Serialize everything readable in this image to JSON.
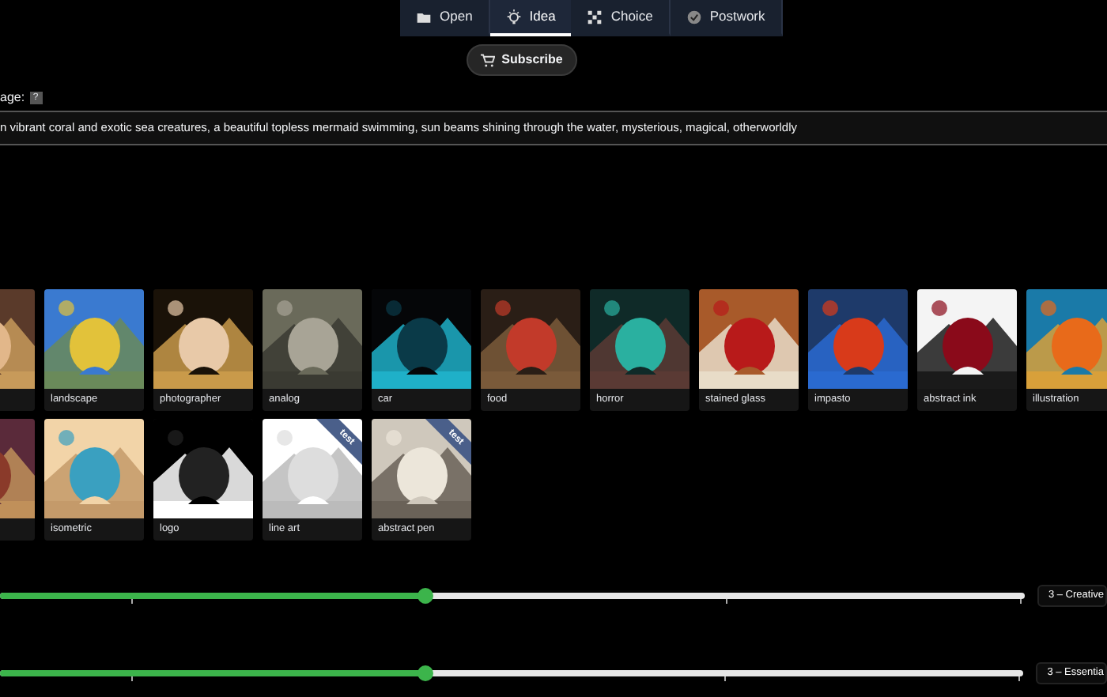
{
  "tabs": [
    {
      "label": "Open",
      "kind": "folder",
      "selected": false
    },
    {
      "label": "Idea",
      "kind": "bulb",
      "selected": true
    },
    {
      "label": "Choice",
      "kind": "grid",
      "selected": false
    },
    {
      "label": "Postwork",
      "kind": "check",
      "selected": false
    }
  ],
  "subscribe_button": "Subscribe",
  "prompt": {
    "label": "age:",
    "help": "?",
    "value": "n vibrant coral and exotic sea creatures, a beautiful topless mermaid swimming, sun beams shining through the water, mysterious, magical, otherworldly"
  },
  "style_rows": [
    [
      {
        "kind": "picture"
      },
      {
        "kind": "style",
        "label": "landscape"
      },
      {
        "kind": "style",
        "label": "photographer"
      },
      {
        "kind": "style",
        "label": "analog"
      },
      {
        "kind": "style",
        "label": "car"
      },
      {
        "kind": "style",
        "label": "food"
      },
      {
        "kind": "style",
        "label": "horror"
      },
      {
        "kind": "style",
        "label": "stained glass"
      },
      {
        "kind": "style",
        "label": "impasto"
      },
      {
        "kind": "style",
        "label": "abstract ink"
      },
      {
        "kind": "style",
        "label": "illustration"
      }
    ],
    [
      {
        "kind": "picture"
      },
      {
        "kind": "style",
        "label": "isometric"
      },
      {
        "kind": "style",
        "label": "logo"
      },
      {
        "kind": "style",
        "label": "line art",
        "badge": "test"
      },
      {
        "kind": "style",
        "label": "abstract pen",
        "badge": "test"
      }
    ]
  ],
  "sliders": [
    {
      "level": 0.415,
      "reading": "3 – Creative"
    },
    {
      "level": 0.415,
      "reading": "3 – Essentia"
    }
  ]
}
